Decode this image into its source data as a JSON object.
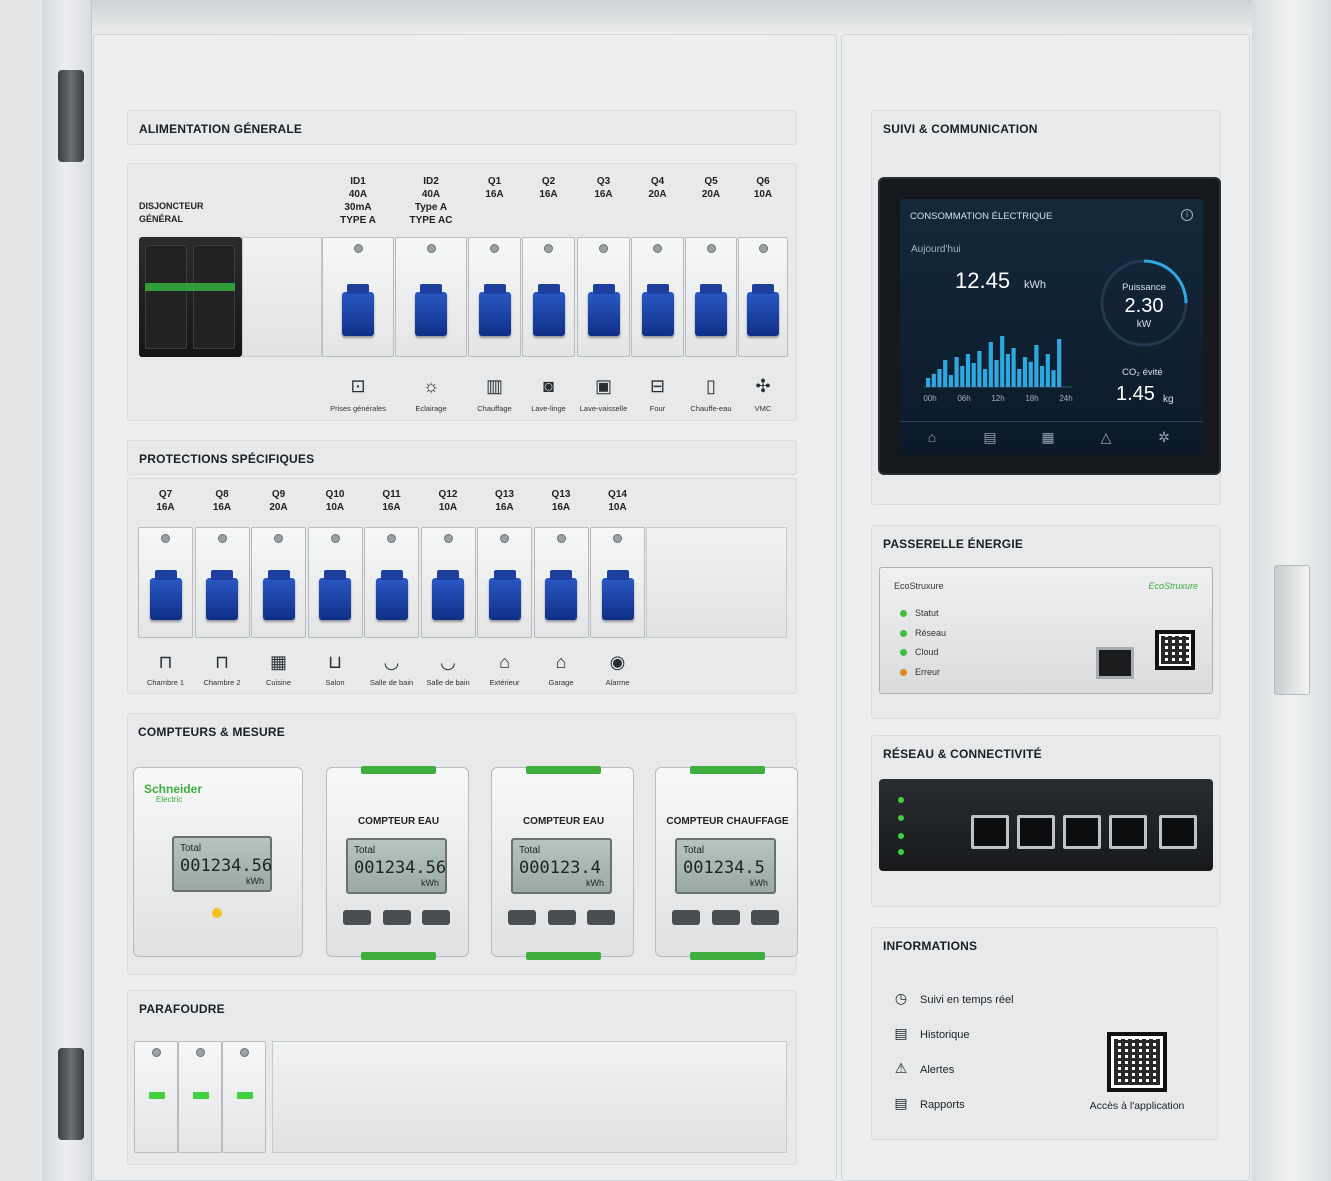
{
  "sections": {
    "alimentation": "ALIMENTATION GÉNERALE",
    "protections": "PROTECTIONS SPÉCIFIQUES",
    "compteurs": "COMPTEURS & MESURE",
    "parafoudre": "PARAFOUDRE",
    "suivi": "SUIVI & COMMUNICATION",
    "passerelle": "PASSERELLE ÉNERGIE",
    "reseau": "RÉSEAU & CONNECTIVITÉ",
    "informations": "INFORMATIONS"
  },
  "main_switch_label": [
    "DISJONCTEUR",
    "GÉNÉRAL"
  ],
  "row1_breakers": [
    {
      "id": "ID1",
      "l2": "40A",
      "l3": "30mA",
      "l4": "TYPE A"
    },
    {
      "id": "ID2",
      "l2": "40A",
      "l3": "Type A",
      "l4": "TYPE AC"
    },
    {
      "id": "Q1",
      "l2": "16A"
    },
    {
      "id": "Q2",
      "l2": "16A"
    },
    {
      "id": "Q3",
      "l2": "16A"
    },
    {
      "id": "Q4",
      "l2": "20A"
    },
    {
      "id": "Q5",
      "l2": "20A"
    },
    {
      "id": "Q6",
      "l2": "10A"
    }
  ],
  "row1_icons": [
    {
      "icon": "outlet-icon",
      "label": "Prises générales"
    },
    {
      "icon": "bulb-icon",
      "label": "Eclairage"
    },
    {
      "icon": "radiator-icon",
      "label": "Chauffage"
    },
    {
      "icon": "washing-machine-icon",
      "label": "Lave-linge"
    },
    {
      "icon": "dishwasher-icon",
      "label": "Lave-vaisselle"
    },
    {
      "icon": "oven-icon",
      "label": "Four"
    },
    {
      "icon": "water-heater-icon",
      "label": "Chauffe-eau"
    },
    {
      "icon": "fan-icon",
      "label": "VMC"
    }
  ],
  "row2_breakers": [
    {
      "id": "Q7",
      "amp": "16A",
      "icon": "bed-icon",
      "label": "Chambre 1"
    },
    {
      "id": "Q8",
      "amp": "16A",
      "icon": "bed-icon",
      "label": "Chambre 2"
    },
    {
      "id": "Q9",
      "amp": "20A",
      "icon": "stove-icon",
      "label": "Cuisine"
    },
    {
      "id": "Q10",
      "amp": "10A",
      "icon": "sofa-icon",
      "label": "Salon"
    },
    {
      "id": "Q11",
      "amp": "16A",
      "icon": "bathtub-icon",
      "label": "Salle de bain"
    },
    {
      "id": "Q12",
      "amp": "10A",
      "icon": "bathtub-icon",
      "label": "Salle de bain"
    },
    {
      "id": "Q13",
      "amp": "16A",
      "icon": "house-icon",
      "label": "Extérieur"
    },
    {
      "id": "Q13",
      "amp": "16A",
      "icon": "garage-icon",
      "label": "Garage"
    },
    {
      "id": "Q14",
      "amp": "10A",
      "icon": "alarm-icon",
      "label": "Alarme"
    }
  ],
  "meters": [
    {
      "brand": "Schneider",
      "brand2": "Electric",
      "title": "",
      "total_label": "Total",
      "value": "001234.56",
      "unit": "kWh"
    },
    {
      "title": "COMPTEUR EAU",
      "total_label": "Total",
      "value": "001234.56",
      "unit": "kWh"
    },
    {
      "title": "COMPTEUR EAU",
      "total_label": "Total",
      "value": "000123.4",
      "unit": "kWh"
    },
    {
      "title": "COMPTEUR CHAUFFAGE",
      "total_label": "Total",
      "value": "001234.5",
      "unit": "kWh"
    }
  ],
  "screen": {
    "title": "CONSOMMATION ÉLECTRIQUE",
    "today_label": "Aujourd'hui",
    "today_value": "12.45",
    "today_unit": "kWh",
    "power_label": "Puissance",
    "power_value": "2.30",
    "power_unit": "kW",
    "power_fraction": 0.25,
    "co2_label": "CO₂ évité",
    "co2_value": "1.45",
    "co2_unit": "kg",
    "x_ticks": [
      "00h",
      "06h",
      "12h",
      "18h",
      "24h"
    ],
    "bars": [
      0.15,
      0.22,
      0.3,
      0.45,
      0.2,
      0.5,
      0.35,
      0.55,
      0.4,
      0.6,
      0.3,
      0.75,
      0.45,
      0.85,
      0.55,
      0.65,
      0.3,
      0.5,
      0.42,
      0.7,
      0.35,
      0.55,
      0.28,
      0.8
    ],
    "nav_icons": [
      "home-icon",
      "chart-icon",
      "calendar-icon",
      "bell-icon",
      "settings-icon"
    ]
  },
  "gateway": {
    "brand": "EcoStruxure",
    "brand_right": "EcoStruxure",
    "statuses": [
      {
        "label": "Statut",
        "color": "#3fbf3f"
      },
      {
        "label": "Réseau",
        "color": "#3fbf3f"
      },
      {
        "label": "Cloud",
        "color": "#3fbf3f"
      },
      {
        "label": "Erreur",
        "color": "#e08a1e"
      }
    ]
  },
  "info": {
    "items": [
      {
        "icon": "clock-icon",
        "label": "Suivi en temps réel"
      },
      {
        "icon": "history-icon",
        "label": "Historique"
      },
      {
        "icon": "warning-icon",
        "label": "Alertes"
      },
      {
        "icon": "report-icon",
        "label": "Rapports"
      }
    ],
    "qr_caption": "Accès à l'application"
  },
  "colors": {
    "breaker_toggle": "#1a43b0",
    "screen_accent": "#2ea8e0",
    "panel": "#eceeef"
  }
}
